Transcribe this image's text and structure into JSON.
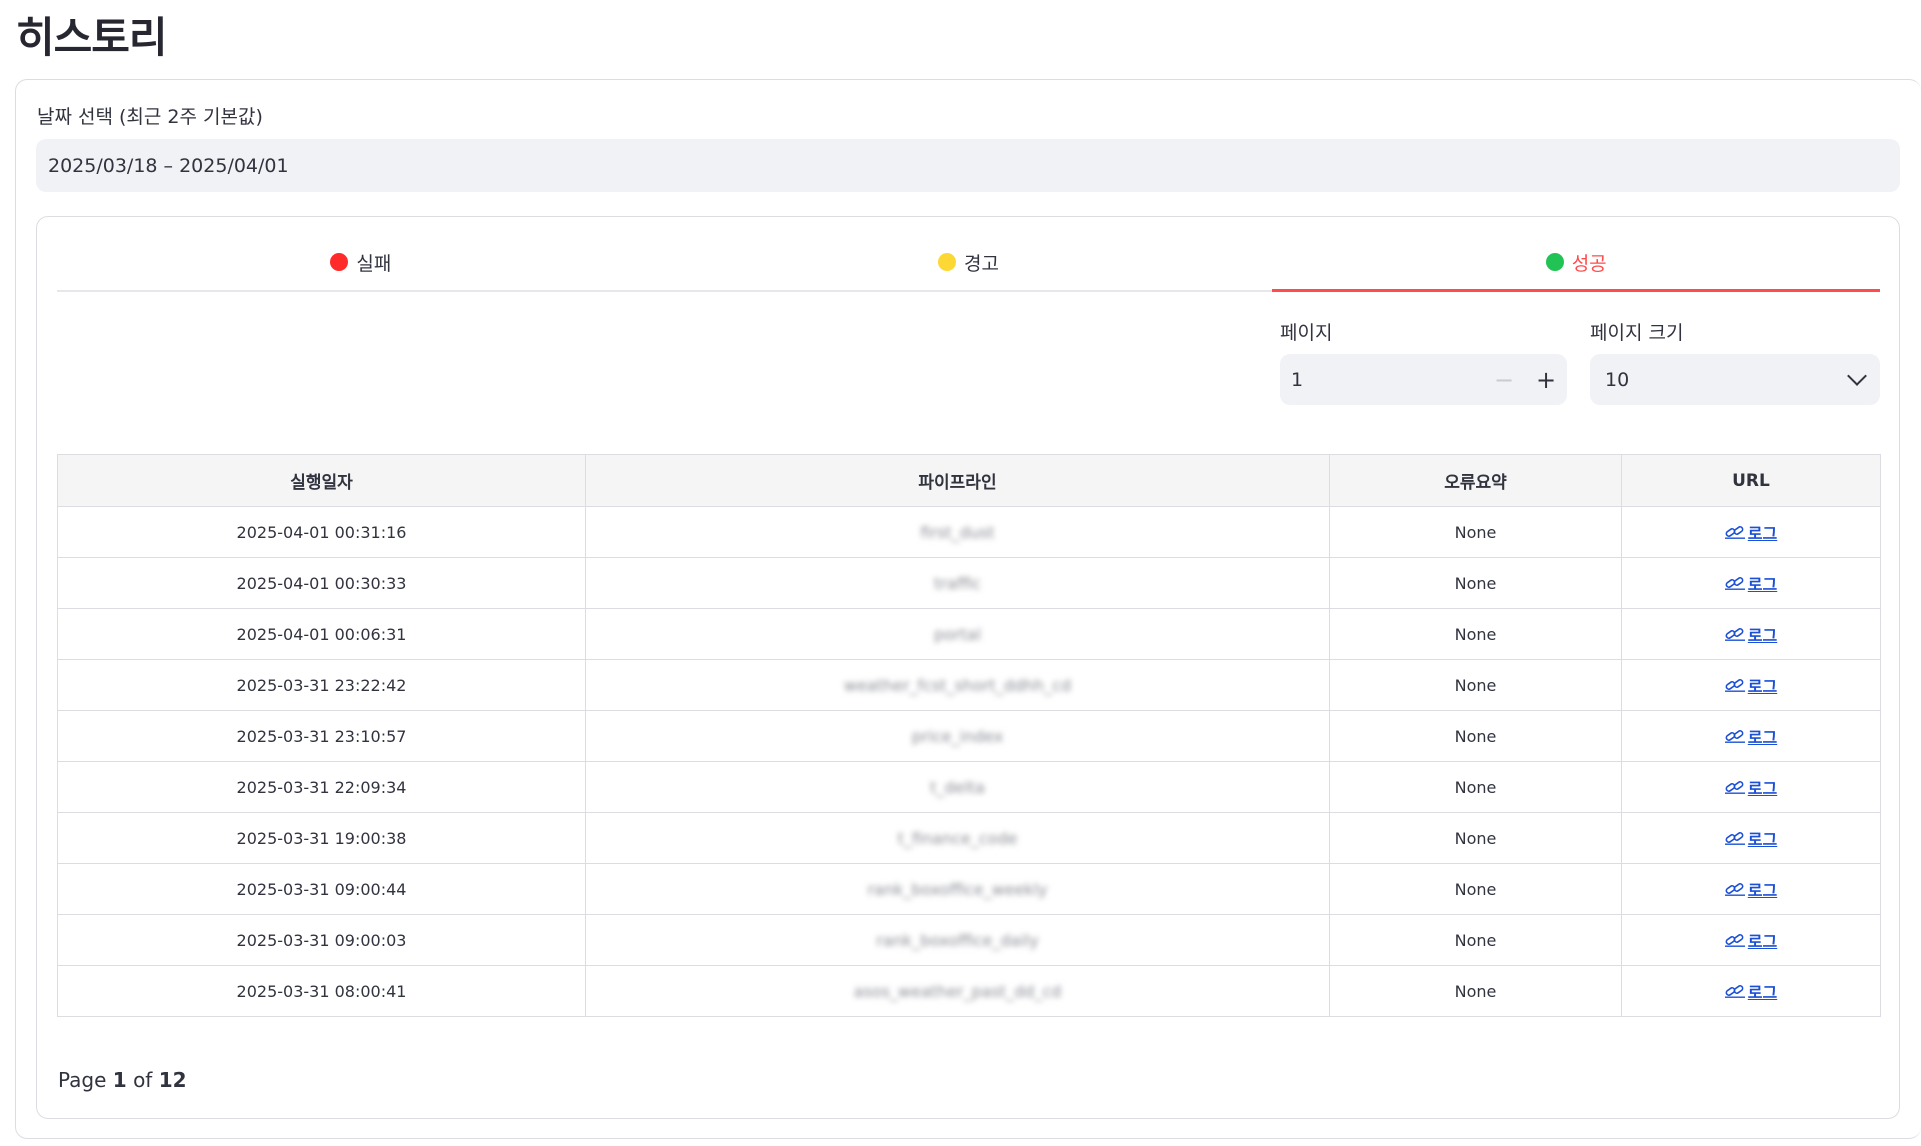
{
  "page": {
    "title": "히스토리"
  },
  "date_picker": {
    "label": "날짜 선택 (최근 2주 기본값)",
    "value": "2025/03/18 – 2025/04/01"
  },
  "tabs": [
    {
      "label": "실패",
      "dot_color": "#ff2b2b"
    },
    {
      "label": "경고",
      "dot_color": "#fdd835"
    },
    {
      "label": "성공",
      "dot_color": "#21c354",
      "active": true
    }
  ],
  "controls": {
    "page_label": "페이지",
    "page_value": "1",
    "minus": "−",
    "plus": "+",
    "page_size_label": "페이지 크기",
    "page_size_value": "10"
  },
  "table": {
    "headers": [
      "실행일자",
      "파이프라인",
      "오류요약",
      "URL"
    ],
    "rows": [
      {
        "date": "2025-04-01 00:31:16",
        "pipeline": "first_dust",
        "error": "None",
        "url": "로그"
      },
      {
        "date": "2025-04-01 00:30:33",
        "pipeline": "traffic",
        "error": "None",
        "url": "로그"
      },
      {
        "date": "2025-04-01 00:06:31",
        "pipeline": "portal",
        "error": "None",
        "url": "로그"
      },
      {
        "date": "2025-03-31 23:22:42",
        "pipeline": "weather_fcst_short_ddhh_cd",
        "error": "None",
        "url": "로그"
      },
      {
        "date": "2025-03-31 23:10:57",
        "pipeline": "price_index",
        "error": "None",
        "url": "로그"
      },
      {
        "date": "2025-03-31 22:09:34",
        "pipeline": "t_delta",
        "error": "None",
        "url": "로그"
      },
      {
        "date": "2025-03-31 19:00:38",
        "pipeline": "t_finance_code",
        "error": "None",
        "url": "로그"
      },
      {
        "date": "2025-03-31 09:00:44",
        "pipeline": "rank_boxoffice_weekly",
        "error": "None",
        "url": "로그"
      },
      {
        "date": "2025-03-31 09:00:03",
        "pipeline": "rank_boxoffice_daily",
        "error": "None",
        "url": "로그"
      },
      {
        "date": "2025-03-31 08:00:41",
        "pipeline": "asos_weather_past_dd_cd",
        "error": "None",
        "url": "로그"
      }
    ]
  },
  "pager": {
    "prefix": "Page",
    "current": "1",
    "of": "of",
    "total": "12"
  }
}
